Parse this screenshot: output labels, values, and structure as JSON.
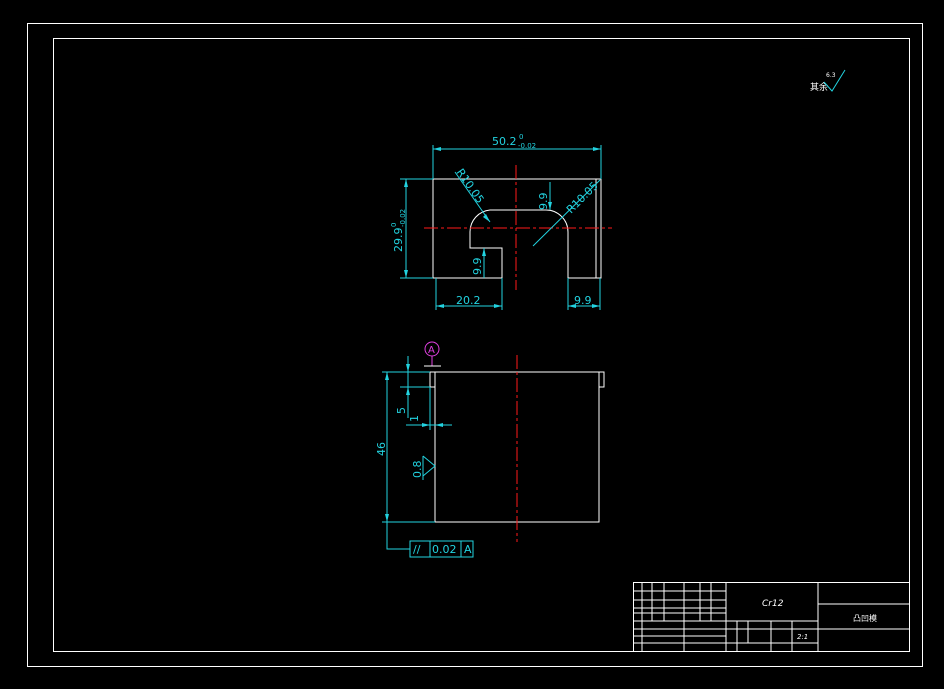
{
  "top_view": {
    "width_dim": "50.2",
    "width_tol_upper": "0",
    "width_tol_lower": "-0.02",
    "height_dim": "29.9",
    "height_tol_upper": "0",
    "height_tol_lower": "-0.02",
    "radius_left": "R10.05",
    "radius_right": "R10.05",
    "slot_depth_upper": "9.9",
    "slot_depth_lower": "9.9",
    "left_width": "20.2",
    "right_width": "9.9"
  },
  "front_view": {
    "datum_label": "A",
    "dim_5": "5",
    "dim_1": "1",
    "dim_46": "46",
    "roughness_side": "0.8",
    "parallelism_symbol": "//",
    "parallelism_value": "0.02",
    "parallelism_datum": "A"
  },
  "roughness_note": {
    "prefix": "其余",
    "value": "6.3"
  },
  "title_block": {
    "material": "Cr12",
    "part_name": "凸凹模",
    "scale": "2:1"
  },
  "colors": {
    "outline": "#ffffff",
    "dimension": "#22d3e0",
    "centerline": "#ff1a1a",
    "datum": "#e040e0"
  }
}
